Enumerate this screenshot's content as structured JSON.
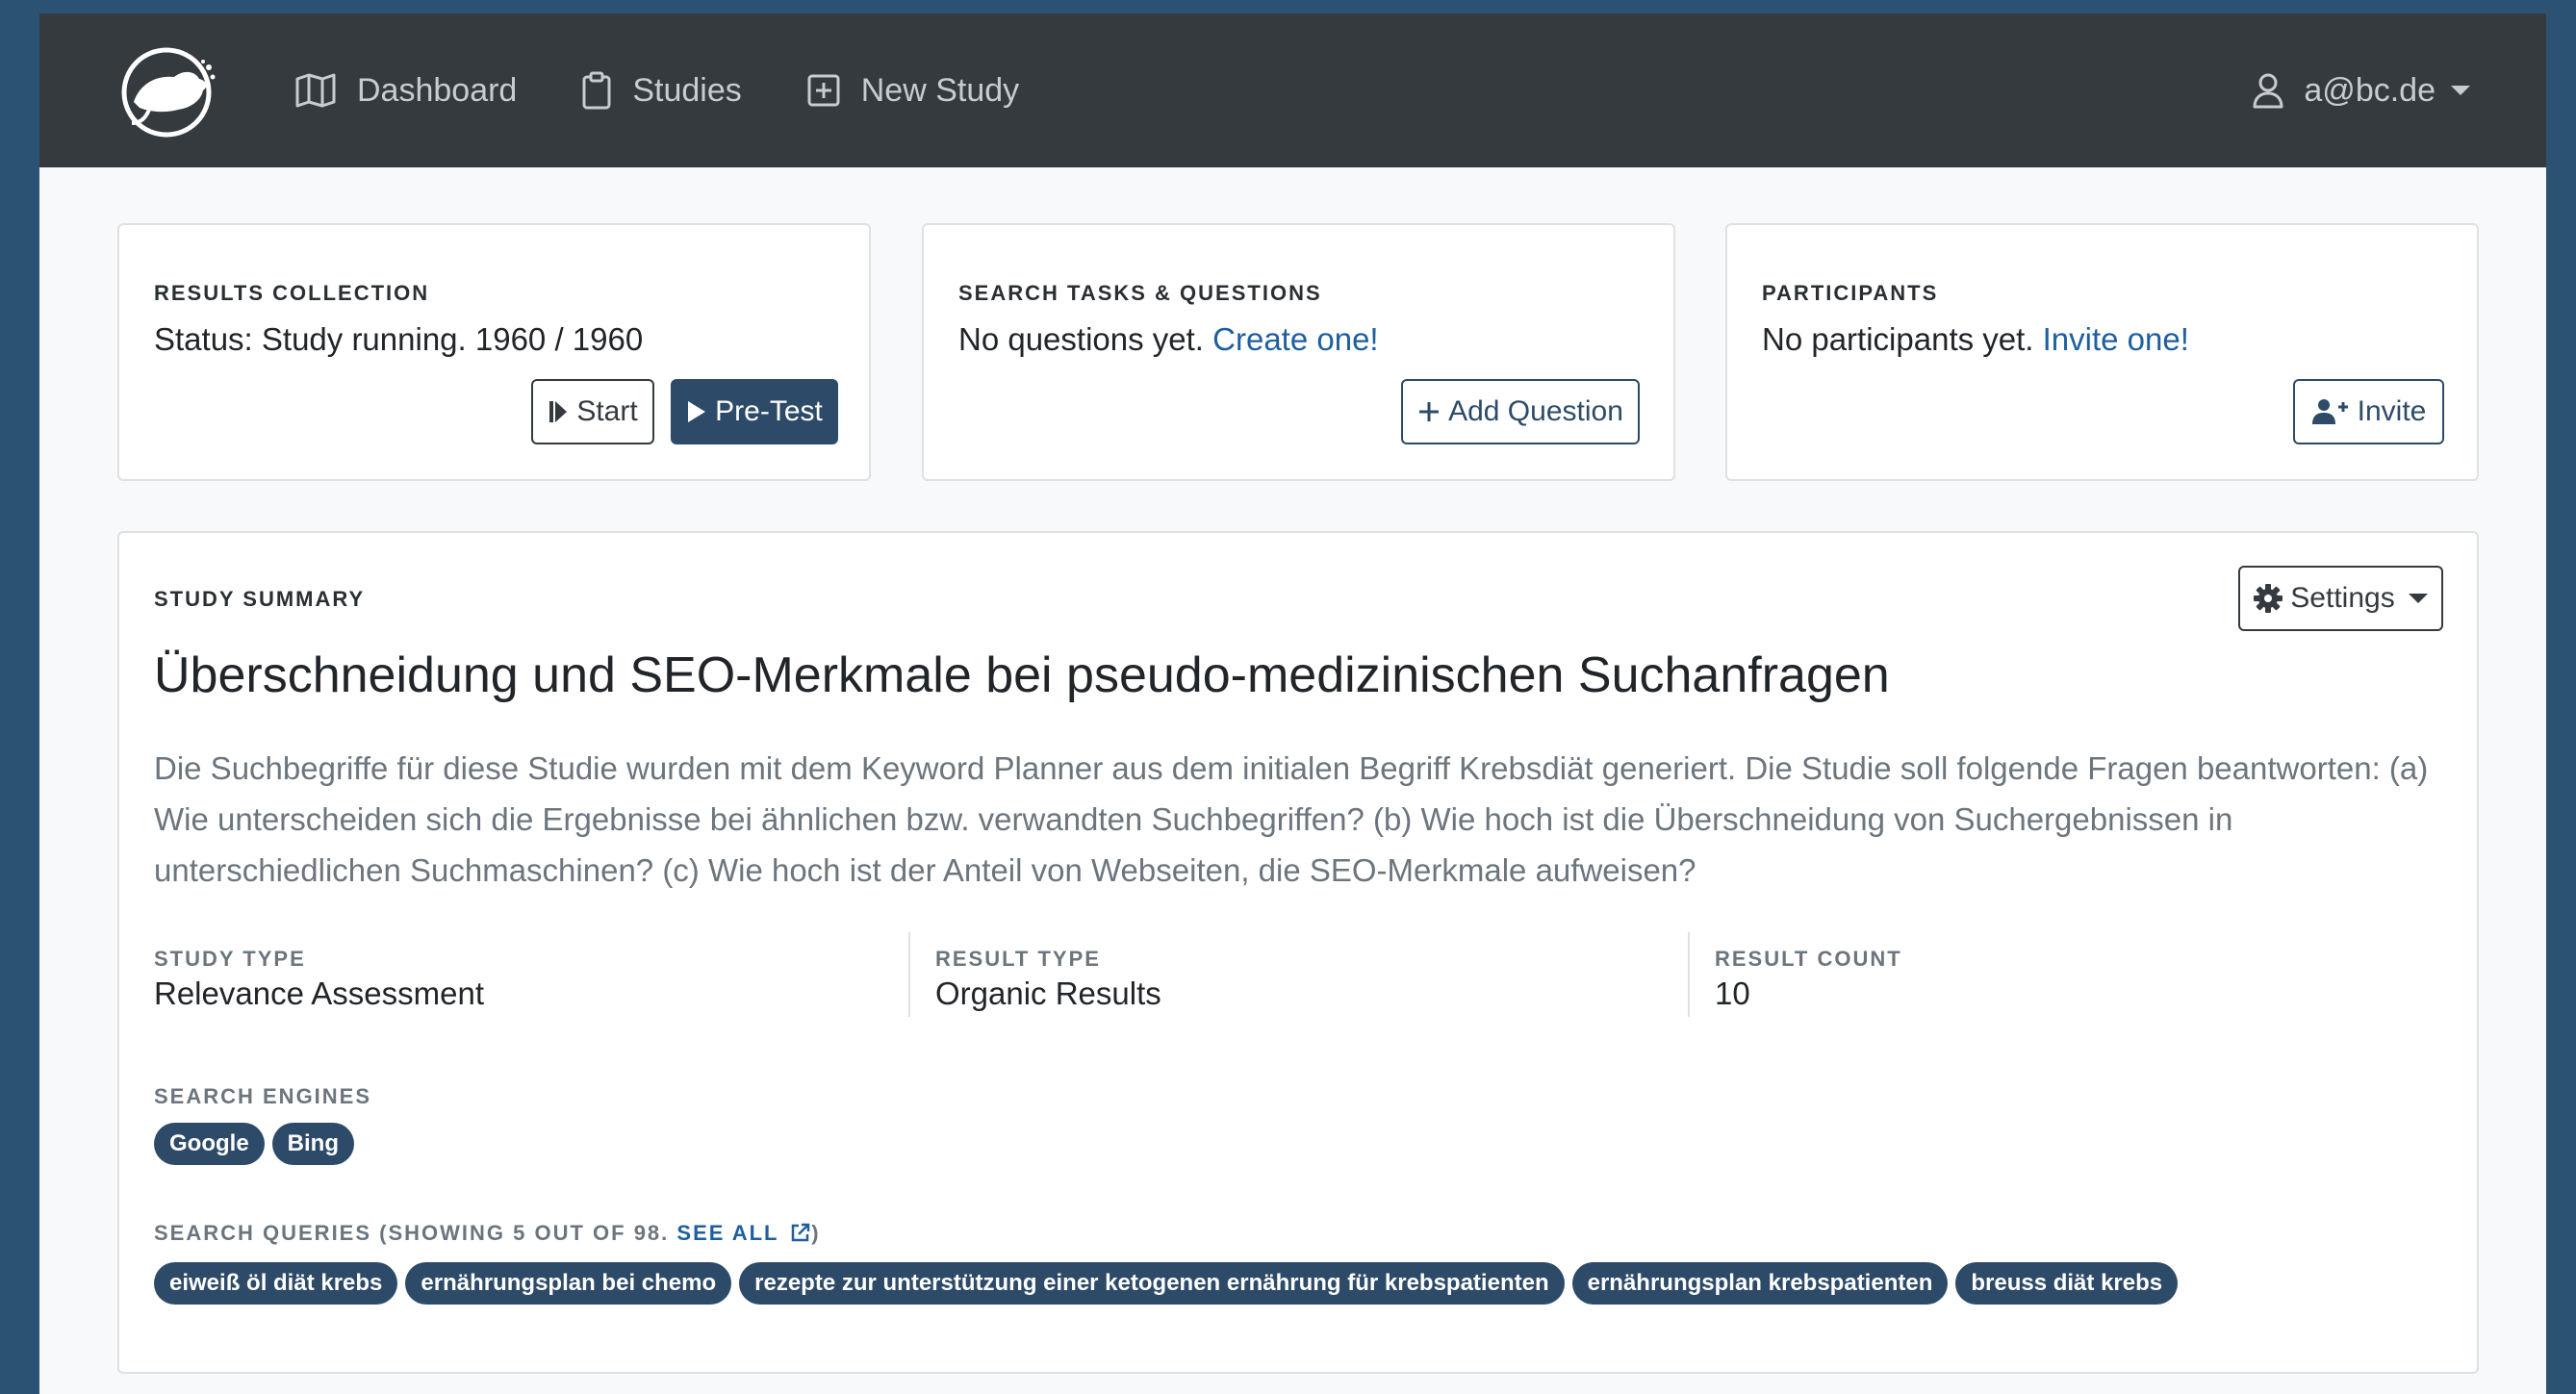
{
  "nav": {
    "dashboard": "Dashboard",
    "studies": "Studies",
    "new_study": "New Study",
    "user": "a@bc.de"
  },
  "results_collection": {
    "label": "Results Collection",
    "status": "Status: Study running. 1960 / 1960",
    "start_label": "Start",
    "pretest_label": "Pre-Test"
  },
  "search_tasks": {
    "label": "Search Tasks & Questions",
    "text": "No questions yet. ",
    "link": "Create one!",
    "add_label": "Add Question"
  },
  "participants": {
    "label": "Participants",
    "text": "No participants yet. ",
    "link": "Invite one!",
    "invite_label": "Invite"
  },
  "study_summary": {
    "label": "Study Summary",
    "settings_label": "Settings",
    "title": "Überschneidung und SEO-Merkmale bei pseudo-medizinischen Suchanfragen",
    "description": "Die Suchbegriffe für diese Studie wurden mit dem Keyword Planner aus dem initialen Begriff Krebsdiät generiert. Die Studie soll folgende Fragen beantworten: (a) Wie unterscheiden sich die Ergebnisse bei ähnlichen bzw. verwandten Suchbegriffen? (b) Wie hoch ist die Überschneidung von Suchergebnissen in unterschiedlichen Suchmaschinen? (c) Wie hoch ist der Anteil von Webseiten, die SEO-Merkmale aufweisen?",
    "study_type_label": "Study Type",
    "study_type": "Relevance Assessment",
    "result_type_label": "Result Type",
    "result_type": "Organic Results",
    "result_count_label": "Result Count",
    "result_count": "10",
    "search_engines_label": "Search Engines",
    "search_engines": [
      "Google",
      "Bing"
    ],
    "queries_label_prefix": "Search Queries (showing 5 out of 98.",
    "see_all": "See all",
    "queries_label_suffix": ")",
    "queries": [
      "eiweiß öl diät krebs",
      "ernährungsplan bei chemo",
      "rezepte zur unterstützung einer ketogenen ernährung für krebspatienten",
      "ernährungsplan krebspatienten",
      "breuss diät krebs"
    ]
  }
}
